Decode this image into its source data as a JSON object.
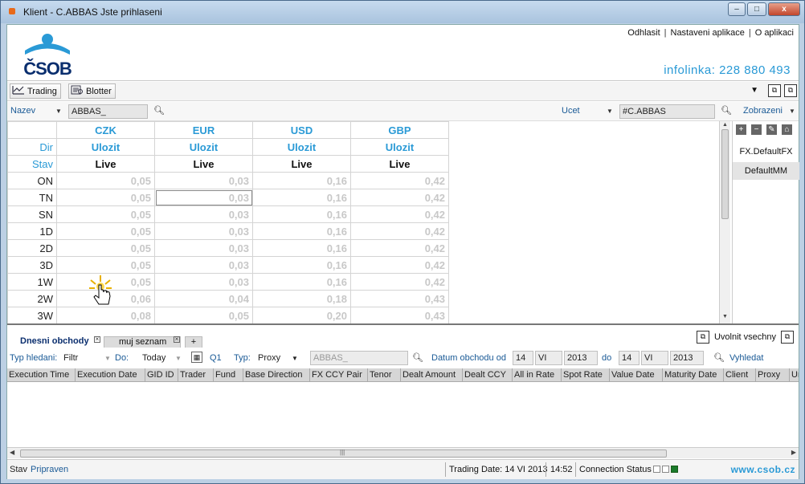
{
  "window": {
    "title": "Klient - C.ABBAS Jste prihlaseni",
    "buttons": {
      "minimize": "–",
      "maximize": "□",
      "close": "x"
    }
  },
  "header": {
    "logo_text": "ČSOB",
    "links": [
      "Odhlasit",
      "Nastaveni aplikace",
      "O aplikaci"
    ],
    "infolinka": "infolinka: 228 880 493"
  },
  "toolbar": {
    "trading_label": "Trading",
    "blotter_label": "Blotter"
  },
  "filterbar": {
    "nazev_label": "Nazev",
    "nazev_value": "ABBAS_",
    "ucet_label": "Ucet",
    "ucet_value": "#C.ABBAS",
    "zobrazeni_label": "Zobrazeni"
  },
  "grid": {
    "currencies": [
      "CZK",
      "EUR",
      "USD",
      "GBP"
    ],
    "dir_label": "Dir",
    "stav_label": "Stav",
    "action_label": "Ulozit",
    "status_label": "Live",
    "rows": [
      {
        "tenor": "ON",
        "values": [
          "0,05",
          "0,03",
          "0,16",
          "0,42"
        ]
      },
      {
        "tenor": "TN",
        "values": [
          "0,05",
          "0,03",
          "0,16",
          "0,42"
        ]
      },
      {
        "tenor": "SN",
        "values": [
          "0,05",
          "0,03",
          "0,16",
          "0,42"
        ]
      },
      {
        "tenor": "1D",
        "values": [
          "0,05",
          "0,03",
          "0,16",
          "0,42"
        ]
      },
      {
        "tenor": "2D",
        "values": [
          "0,05",
          "0,03",
          "0,16",
          "0,42"
        ]
      },
      {
        "tenor": "3D",
        "values": [
          "0,05",
          "0,03",
          "0,16",
          "0,42"
        ]
      },
      {
        "tenor": "1W",
        "values": [
          "0,05",
          "0,03",
          "0,16",
          "0,42"
        ]
      },
      {
        "tenor": "2W",
        "values": [
          "0,06",
          "0,04",
          "0,18",
          "0,43"
        ]
      },
      {
        "tenor": "3W",
        "values": [
          "0,08",
          "0,05",
          "0,20",
          "0,43"
        ]
      }
    ]
  },
  "sidepanel": {
    "items": [
      "FX.DefaultFX",
      "DefaultMM"
    ]
  },
  "lower": {
    "tabs": {
      "active": "Dnesni obchody",
      "other": "muj seznam",
      "plus": "+"
    },
    "uvolnit": "Uvolnit vsechny"
  },
  "filter2": {
    "typ_hledani_label": "Typ hledani:",
    "typ_hledani_value": "Filtr",
    "do_label": "Do:",
    "do_value": "Today",
    "q1": "Q1",
    "typ_label": "Typ:",
    "typ_value": "Proxy",
    "search_value": "ABBAS_",
    "datum_label": "Datum obchodu od",
    "from_day": "14",
    "from_month": "VI",
    "from_year": "2013",
    "do2_label": "do",
    "to_day": "14",
    "to_month": "VI",
    "to_year": "2013",
    "vyhledat": "Vyhledat"
  },
  "columns": [
    "Execution Time",
    "Execution Date",
    "GID ID",
    "Trader",
    "Fund",
    "Base Direction",
    "FX CCY Pair",
    "Tenor",
    "Dealt Amount",
    "Dealt CCY",
    "All in Rate",
    "Spot Rate",
    "Value Date",
    "Maturity Date",
    "Client",
    "Proxy",
    "Uni"
  ],
  "status": {
    "stav_label": "Stav",
    "stav_value": "Pripraven",
    "trading_date": "Trading Date: 14 VI 2013",
    "time": "14:52",
    "connection": "Connection Status",
    "www": "www.csob.cz"
  },
  "colors": {
    "accent": "#2a9ad6",
    "brand": "#0a2e6e",
    "connected": "#1a7a2a"
  }
}
